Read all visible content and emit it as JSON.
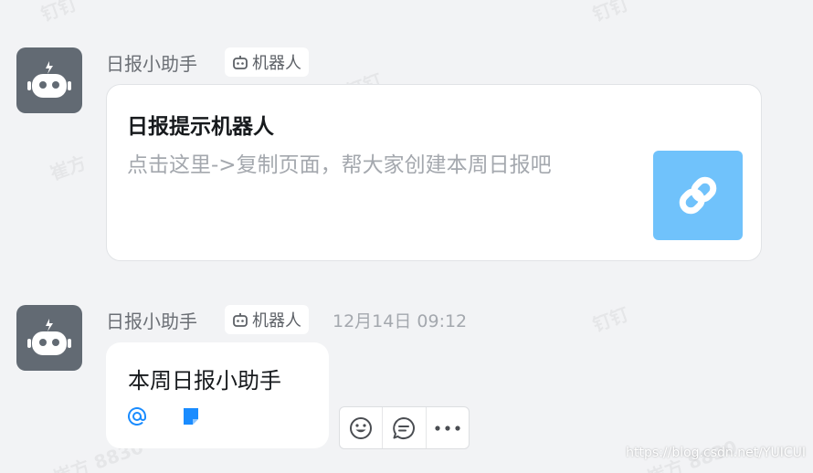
{
  "watermarks": [
    {
      "text": "钉钉"
    },
    {
      "text": "钉钉"
    },
    {
      "text": "崔方"
    },
    {
      "text": "钉钉"
    },
    {
      "text": "钉钉"
    },
    {
      "text": "崔方 8830"
    },
    {
      "text": "崔方 8830"
    }
  ],
  "messages": [
    {
      "sender": "日报小助手",
      "bot_tag": "机器人",
      "timestamp": "",
      "card": {
        "title": "日报提示机器人",
        "description": "点击这里->复制页面，帮大家创建本周日报吧",
        "thumb_color": "#70c2fb"
      }
    },
    {
      "sender": "日报小助手",
      "bot_tag": "机器人",
      "timestamp": "12月14日 09:12",
      "text": "本周日报小助手"
    }
  ],
  "actions": {
    "emoji": "emoji-reaction",
    "reply": "reply-comment",
    "more": "more-options"
  },
  "footer": {
    "credit": "https://blog.csdn.net/YUICUI"
  },
  "colors": {
    "background": "#f2f3f5",
    "avatar": "#626a73",
    "link_blue": "#1a8cff",
    "thumb": "#70c2fb"
  }
}
